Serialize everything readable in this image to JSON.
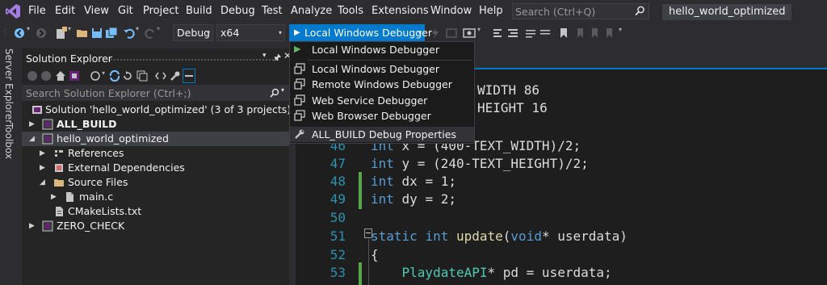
{
  "menu": {
    "items": [
      "File",
      "Edit",
      "View",
      "Git",
      "Project",
      "Build",
      "Debug",
      "Test",
      "Analyze",
      "Tools",
      "Extensions",
      "Window",
      "Help"
    ],
    "search_placeholder": "Search (Ctrl+Q)",
    "window_title": "hello_world_optimized"
  },
  "toolbar": {
    "configuration": "Debug",
    "platform": "x64",
    "debugger": "Local Windows Debugger"
  },
  "side_tabs": [
    "Server Explorer",
    "Toolbox"
  ],
  "solution_explorer": {
    "title": "Solution Explorer",
    "search_placeholder": "Search Solution Explorer (Ctrl+;)",
    "tree": [
      {
        "label": "Solution 'hello_world_optimized' (3 of 3 projects)"
      },
      {
        "label": "ALL_BUILD"
      },
      {
        "label": "hello_world_optimized"
      },
      {
        "label": "References"
      },
      {
        "label": "External Dependencies"
      },
      {
        "label": "Source Files"
      },
      {
        "label": "main.c"
      },
      {
        "label": "CMakeLists.txt"
      },
      {
        "label": "ZERO_CHECK"
      }
    ]
  },
  "debugger_menu": {
    "items": [
      {
        "label": "Local Windows Debugger",
        "icon": "play-icon"
      },
      {
        "label": "Local Windows Debugger",
        "icon": "window-icon"
      },
      {
        "label": "Remote Windows Debugger",
        "icon": "window-icon"
      },
      {
        "label": "Web Service Debugger",
        "icon": "window-icon"
      },
      {
        "label": "Web Browser Debugger",
        "icon": "window-icon"
      },
      {
        "label": "ALL_BUILD Debug Properties",
        "icon": "wrench-icon"
      }
    ]
  },
  "editor": {
    "lines": [
      {
        "num": "",
        "tokens": [
          {
            "t": "WIDTH 86",
            "c": "pp"
          }
        ]
      },
      {
        "num": "",
        "tokens": [
          {
            "t": "HEIGHT 16",
            "c": "pp"
          }
        ]
      },
      {
        "num": "46",
        "tokens": [
          {
            "t": "int",
            "c": "kw"
          },
          {
            "t": " x = (400-TEXT_WIDTH)/2;",
            "c": "pp"
          }
        ]
      },
      {
        "num": "47",
        "tokens": [
          {
            "t": "int",
            "c": "kw"
          },
          {
            "t": " y = (240-TEXT_HEIGHT)/2;",
            "c": "pp"
          }
        ]
      },
      {
        "num": "48",
        "tokens": [
          {
            "t": "int",
            "c": "kw"
          },
          {
            "t": " dx = 1;",
            "c": "pp"
          }
        ]
      },
      {
        "num": "49",
        "tokens": [
          {
            "t": "int",
            "c": "kw"
          },
          {
            "t": " dy = 2;",
            "c": "pp"
          }
        ]
      },
      {
        "num": "50",
        "tokens": []
      },
      {
        "num": "51",
        "tokens": [
          {
            "t": "static",
            "c": "kw"
          },
          {
            "t": " ",
            "c": "pp"
          },
          {
            "t": "int",
            "c": "kw"
          },
          {
            "t": " ",
            "c": "pp"
          },
          {
            "t": "update",
            "c": "fn"
          },
          {
            "t": "(",
            "c": "pp"
          },
          {
            "t": "void",
            "c": "kw"
          },
          {
            "t": "* userdata)",
            "c": "pp"
          }
        ]
      },
      {
        "num": "52",
        "tokens": [
          {
            "t": "{",
            "c": "pp"
          }
        ]
      },
      {
        "num": "53",
        "tokens": [
          {
            "t": "    ",
            "c": "pp"
          },
          {
            "t": "PlaydateAPI",
            "c": "ty"
          },
          {
            "t": "* pd = userdata;",
            "c": "pp"
          }
        ]
      }
    ]
  },
  "colors": {
    "accent": "#007acc",
    "background": "#2d2d30",
    "editor_bg": "#1e1e1e",
    "keyword": "#569cd6",
    "line_number": "#2b91af",
    "change_bar": "#57a64a"
  }
}
